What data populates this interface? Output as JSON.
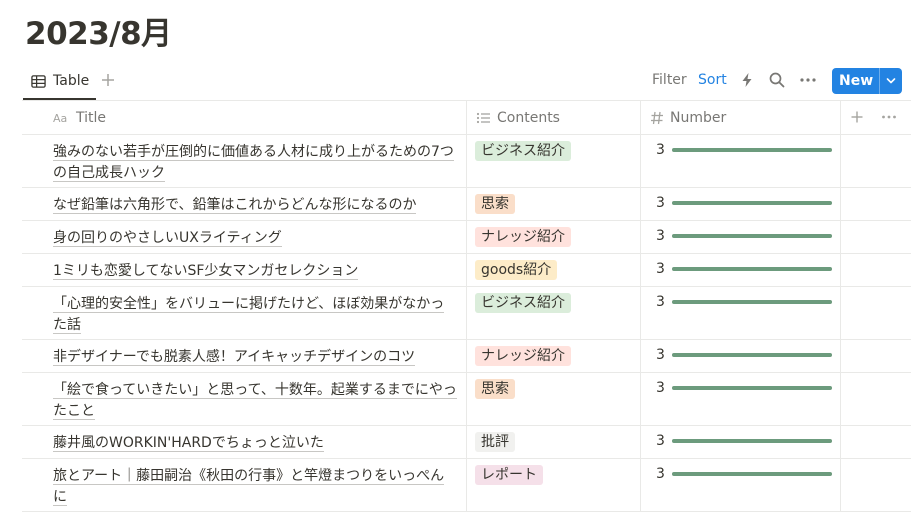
{
  "page": {
    "title": "2023/8月"
  },
  "toolbar": {
    "view_tab_label": "Table",
    "filter_label": "Filter",
    "sort_label": "Sort",
    "new_label": "New"
  },
  "table": {
    "columns": [
      {
        "label": "Title",
        "icon": "text-aa-icon"
      },
      {
        "label": "Contents",
        "icon": "list-icon"
      },
      {
        "label": "Number",
        "icon": "hash-icon"
      }
    ],
    "rows": [
      {
        "title": "強みのない若手が圧倒的に価値ある人材に成り上がるための7つの自己成長ハック",
        "tag": "ビジネス紹介",
        "tag_color": "#dbeddb",
        "number": "3",
        "progress": 1.0
      },
      {
        "title": "なぜ鉛筆は六角形で、鉛筆はこれからどんな形になるのか",
        "tag": "思索",
        "tag_color": "#fadec9",
        "number": "3",
        "progress": 1.0
      },
      {
        "title": "身の回りのやさしいUXライティング",
        "tag": "ナレッジ紹介",
        "tag_color": "#ffe2dd",
        "number": "3",
        "progress": 1.0
      },
      {
        "title": "1ミリも恋愛してないSF少女マンガセレクション",
        "tag": "goods紹介",
        "tag_color": "#fdecc8",
        "number": "3",
        "progress": 1.0
      },
      {
        "title": "「心理的安全性」をバリューに掲げたけど、ほぼ効果がなかった話",
        "tag": "ビジネス紹介",
        "tag_color": "#dbeddb",
        "number": "3",
        "progress": 1.0
      },
      {
        "title": "非デザイナーでも脱素人感！アイキャッチデザインのコツ",
        "tag": "ナレッジ紹介",
        "tag_color": "#ffe2dd",
        "number": "3",
        "progress": 1.0
      },
      {
        "title": "「絵で食っていきたい」と思って、十数年。起業するまでにやったこと",
        "tag": "思索",
        "tag_color": "#fadec9",
        "number": "3",
        "progress": 1.0
      },
      {
        "title": "藤井風のWORKIN'HARDでちょっと泣いた",
        "tag": "批評",
        "tag_color": "#f1f1ef",
        "number": "3",
        "progress": 1.0
      },
      {
        "title": "旅とアート｜藤田嗣治《秋田の行事》と竿燈まつりをいっぺんに",
        "tag": "レポート",
        "tag_color": "#f5e0e9",
        "number": "3",
        "progress": 1.0
      }
    ]
  },
  "colors": {
    "accent": "#2383e2",
    "progress_fill": "#6c9b7d"
  }
}
